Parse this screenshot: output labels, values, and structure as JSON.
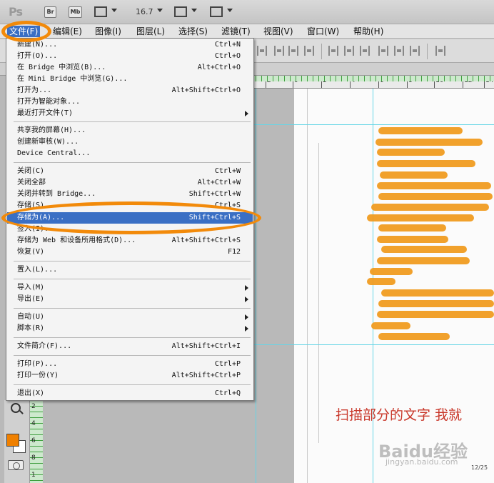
{
  "app": {
    "logo": "Ps",
    "bridge_button": "Br",
    "minibridge_button": "Mb",
    "zoom_level": "16.7"
  },
  "menubar": [
    {
      "label": "文件(F)"
    },
    {
      "label": "编辑(E)"
    },
    {
      "label": "图像(I)"
    },
    {
      "label": "图层(L)"
    },
    {
      "label": "选择(S)"
    },
    {
      "label": "滤镜(T)"
    },
    {
      "label": "视图(V)"
    },
    {
      "label": "窗口(W)"
    },
    {
      "label": "帮助(H)"
    }
  ],
  "file_menu": {
    "items": [
      {
        "label": "新建(N)...",
        "shortcut": "Ctrl+N"
      },
      {
        "label": "打开(O)...",
        "shortcut": "Ctrl+O"
      },
      {
        "label": "在 Bridge 中浏览(B)...",
        "shortcut": "Alt+Ctrl+O"
      },
      {
        "label": "在 Mini Bridge 中浏览(G)...",
        "shortcut": ""
      },
      {
        "label": "打开为...",
        "shortcut": "Alt+Shift+Ctrl+O"
      },
      {
        "label": "打开为智能对象...",
        "shortcut": ""
      },
      {
        "label": "最近打开文件(T)",
        "shortcut": ""
      },
      {
        "label": "共享我的屏幕(H)...",
        "shortcut": ""
      },
      {
        "label": "创建新审核(W)...",
        "shortcut": ""
      },
      {
        "label": "Device Central...",
        "shortcut": ""
      },
      {
        "label": "关闭(C)",
        "shortcut": "Ctrl+W"
      },
      {
        "label": "关闭全部",
        "shortcut": "Alt+Ctrl+W"
      },
      {
        "label": "关闭并转到 Bridge...",
        "shortcut": "Shift+Ctrl+W"
      },
      {
        "label": "存储(S)",
        "shortcut": "Ctrl+S"
      },
      {
        "label": "存储为(A)...",
        "shortcut": "Shift+Ctrl+S"
      },
      {
        "label": "签入(I)...",
        "shortcut": ""
      },
      {
        "label": "存储为 Web 和设备所用格式(D)...",
        "shortcut": "Alt+Shift+Ctrl+S"
      },
      {
        "label": "恢复(V)",
        "shortcut": "F12"
      },
      {
        "label": "置入(L)...",
        "shortcut": ""
      },
      {
        "label": "导入(M)",
        "shortcut": ""
      },
      {
        "label": "导出(E)",
        "shortcut": ""
      },
      {
        "label": "自动(U)",
        "shortcut": ""
      },
      {
        "label": "脚本(R)",
        "shortcut": ""
      },
      {
        "label": "文件简介(F)...",
        "shortcut": "Alt+Shift+Ctrl+I"
      },
      {
        "label": "打印(P)...",
        "shortcut": "Ctrl+P"
      },
      {
        "label": "打印一份(Y)",
        "shortcut": "Alt+Shift+Ctrl+P"
      },
      {
        "label": "退出(X)",
        "shortcut": "Ctrl+Q"
      }
    ]
  },
  "ruler": {
    "h_labels": [
      "2",
      "0",
      "2",
      "4",
      "6",
      "8",
      "10",
      "12",
      "14"
    ],
    "v_labels": [
      "2",
      "4",
      "6",
      "8",
      "1"
    ]
  },
  "document": {
    "scanned_text": "扫描部分的文字  我就",
    "watermark_main": "Baidu经验",
    "watermark_sub": "jingyan.baidu.com",
    "page_number": "12/25"
  },
  "colors": {
    "accent": "#3a6fc4",
    "annotation": "#f28a0a",
    "foreground_swatch": "#f08000",
    "background_swatch": "#ffffff"
  }
}
